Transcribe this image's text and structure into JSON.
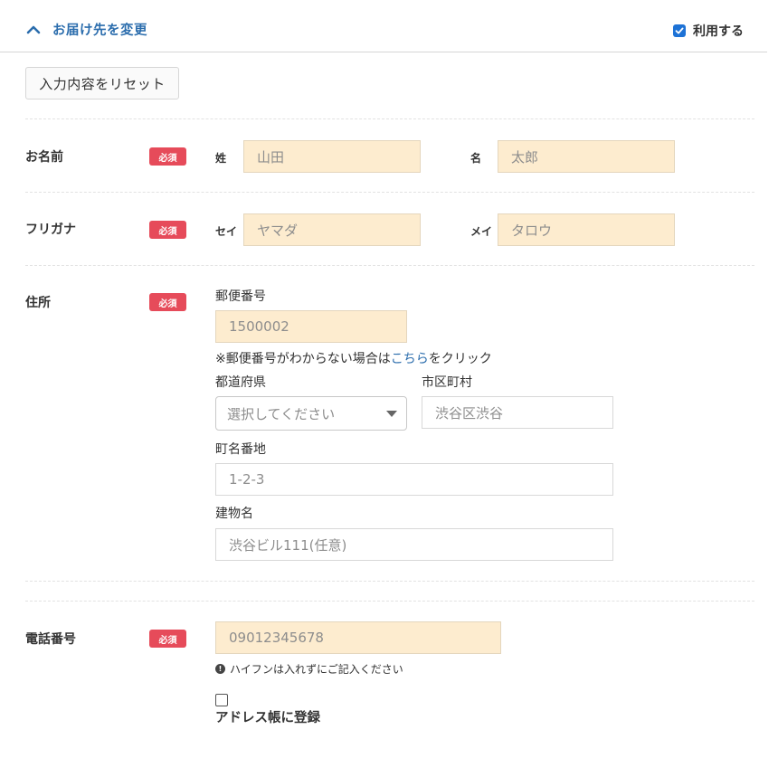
{
  "header": {
    "title": "お届け先を変更",
    "use_label": "利用する",
    "use_checked": true
  },
  "reset_button": "入力内容をリセット",
  "required_badge": "必須",
  "name": {
    "label": "お名前",
    "last_label": "姓",
    "last_value": "山田",
    "first_label": "名",
    "first_value": "太郎"
  },
  "furigana": {
    "label": "フリガナ",
    "last_label": "セイ",
    "last_value": "ヤマダ",
    "first_label": "メイ",
    "first_value": "タロウ"
  },
  "address": {
    "label": "住所",
    "postal_label": "郵便番号",
    "postal_value": "1500002",
    "note_prefix": "※郵便番号がわからない場合は",
    "note_link": "こちら",
    "note_suffix": "をクリック",
    "prefecture_label": "都道府県",
    "prefecture_placeholder": "選択してください",
    "city_label": "市区町村",
    "city_value": "渋谷区渋谷",
    "street_label": "町名番地",
    "street_value": "1-2-3",
    "building_label": "建物名",
    "building_value": "渋谷ビル111(任意)"
  },
  "phone": {
    "label": "電話番号",
    "value": "09012345678",
    "hint": "ハイフンは入れずにご記入ください"
  },
  "address_book": {
    "label": "アドレス帳に登録",
    "checked": false
  }
}
